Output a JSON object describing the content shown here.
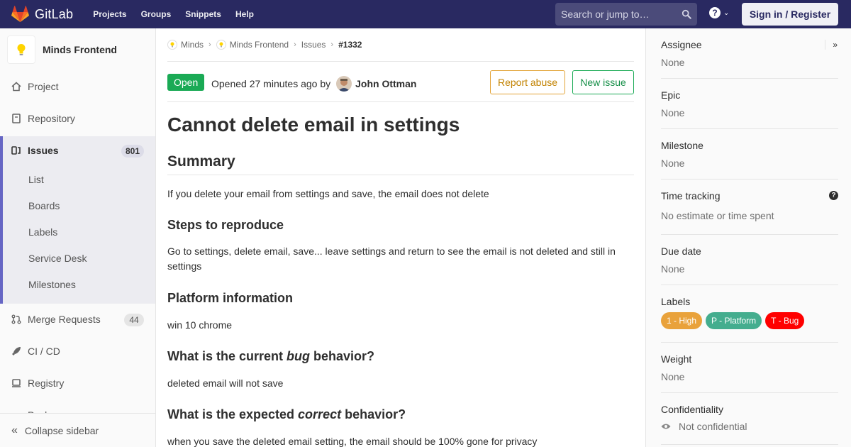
{
  "navbar": {
    "brand": "GitLab",
    "links": [
      "Projects",
      "Groups",
      "Snippets",
      "Help"
    ],
    "search_placeholder": "Search or jump to…",
    "help_icon": "question-circle-icon",
    "signin_label": "Sign in / Register",
    "brand_color": "#292961"
  },
  "sidebar": {
    "project_name": "Minds Frontend",
    "items": [
      {
        "label": "Project",
        "icon": "home-icon"
      },
      {
        "label": "Repository",
        "icon": "book-icon"
      },
      {
        "label": "Issues",
        "icon": "issues-icon",
        "count": "801"
      },
      {
        "label": "Merge Requests",
        "icon": "merge-request-icon",
        "count": "44"
      },
      {
        "label": "CI / CD",
        "icon": "rocket-icon"
      },
      {
        "label": "Registry",
        "icon": "container-icon"
      }
    ],
    "issues_sub": [
      "List",
      "Boards",
      "Labels",
      "Service Desk",
      "Milestones"
    ],
    "clipped_item": "Packages",
    "collapse_label": "Collapse sidebar"
  },
  "breadcrumbs": [
    "Minds",
    "Minds Frontend",
    "Issues",
    "#1332"
  ],
  "issue": {
    "status": "Open",
    "opened_text": "Opened 27 minutes ago by",
    "author": "John Ottman",
    "report_abuse": "Report abuse",
    "new_issue": "New issue",
    "title": "Cannot delete email in settings",
    "summary_heading": "Summary",
    "summary_text": "If you delete your email from settings and save, the email does not delete",
    "steps_heading": "Steps to reproduce",
    "steps_text": "Go to settings, delete email, save... leave settings and return to see the email is not deleted and still in settings",
    "platform_heading": "Platform information",
    "platform_text": "win 10 chrome",
    "current_heading_a": "What is the current ",
    "current_heading_em": "bug",
    "current_heading_b": " behavior?",
    "current_text": "deleted email will not save",
    "expected_heading_a": "What is the expected ",
    "expected_heading_em": "correct",
    "expected_heading_b": " behavior?",
    "expected_text": "when you save the deleted email setting, the email should be 100% gone for privacy"
  },
  "right_sidebar": {
    "assignee_title": "Assignee",
    "assignee_value": "None",
    "epic_title": "Epic",
    "epic_value": "None",
    "milestone_title": "Milestone",
    "milestone_value": "None",
    "time_title": "Time tracking",
    "time_value": "No estimate or time spent",
    "due_title": "Due date",
    "due_value": "None",
    "labels_title": "Labels",
    "labels": [
      {
        "text": "1 - High",
        "color": "#e9a23b"
      },
      {
        "text": "P - Platform",
        "color": "#44ad8e"
      },
      {
        "text": "T - Bug",
        "color": "#ff0000"
      }
    ],
    "weight_title": "Weight",
    "weight_value": "None",
    "confidentiality_title": "Confidentiality",
    "confidentiality_value": "Not confidential"
  }
}
